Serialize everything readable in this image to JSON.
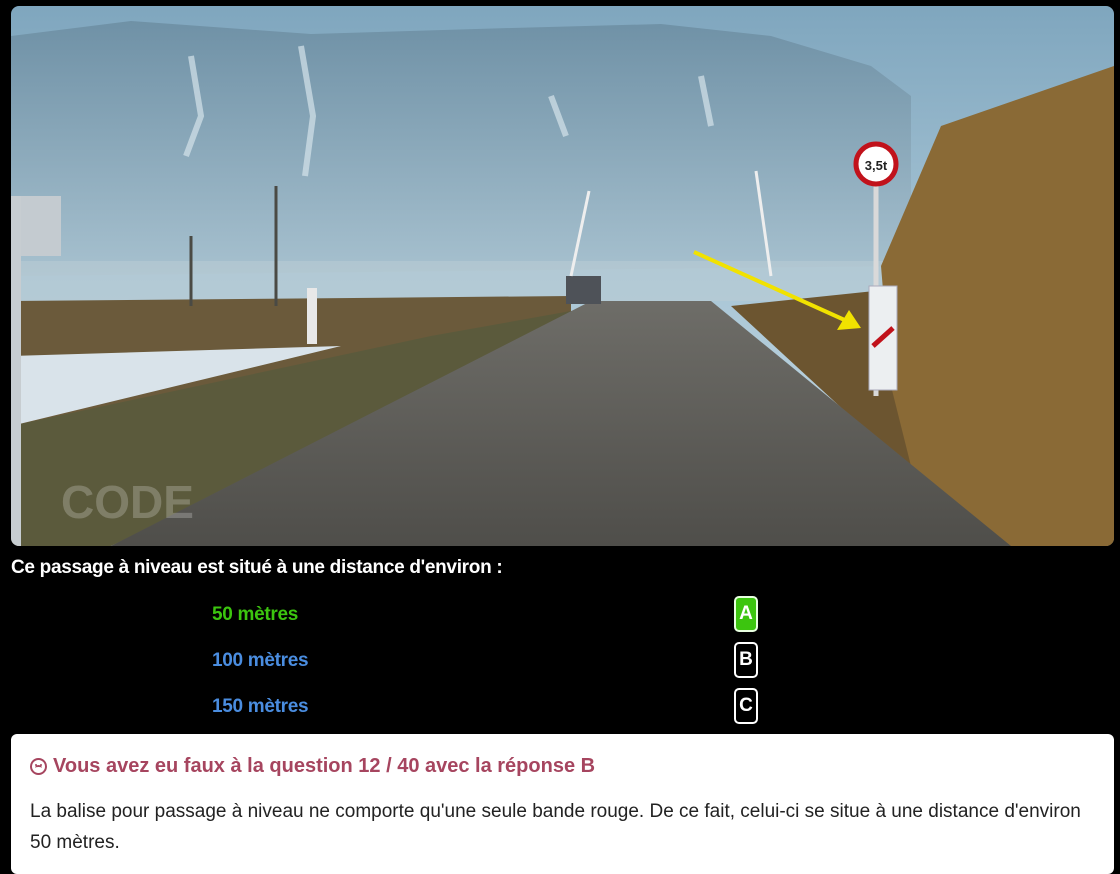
{
  "photo": {
    "sign_label": "3,5t",
    "watermark": "CODE"
  },
  "question": "Ce passage à niveau est situé à une distance d'environ :",
  "answers": [
    {
      "text": "50 mètres",
      "key": "A",
      "color": "#3cc50f",
      "correct": true
    },
    {
      "text": "100 mètres",
      "key": "B",
      "color": "#4a8de0",
      "correct": false
    },
    {
      "text": "150 mètres",
      "key": "C",
      "color": "#4a8de0",
      "correct": false
    }
  ],
  "feedback": {
    "title": "Vous avez eu faux à la question 12 / 40 avec la réponse B",
    "icon": "sad-face-icon",
    "explanation": "La balise pour passage à niveau ne comporte qu'une seule bande rouge. De ce fait, celui-ci se situe à une distance d'environ 50 mètres.",
    "title_color": "#a6455f"
  }
}
